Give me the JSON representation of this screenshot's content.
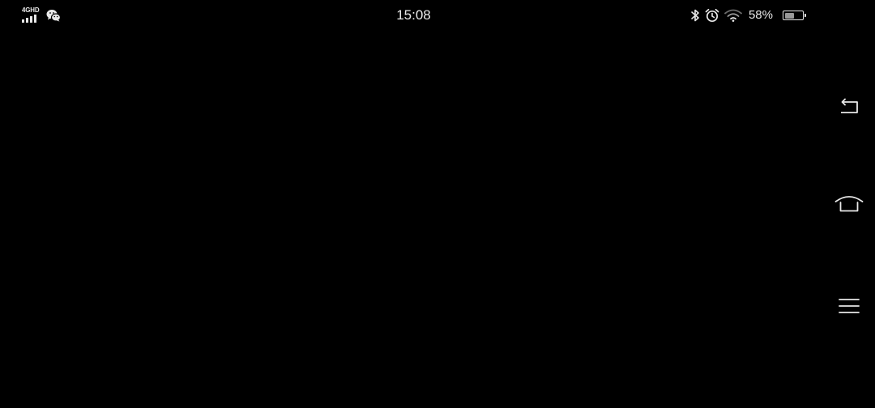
{
  "status_bar": {
    "network_type": "4GHD",
    "signal_level": 4,
    "notification_icons": [
      "wechat-icon"
    ],
    "time": "15:08",
    "system_icons": [
      "bluetooth-icon",
      "alarm-icon",
      "wifi-icon"
    ],
    "battery_percent_text": "58%",
    "battery_level": 0.58,
    "text_color": "#e8e8e8"
  },
  "screen": {
    "background": "#000000"
  },
  "navigation_bar": {
    "buttons": [
      "back-icon",
      "home-icon",
      "menu-icon"
    ],
    "icon_color": "#e8e8e8"
  }
}
